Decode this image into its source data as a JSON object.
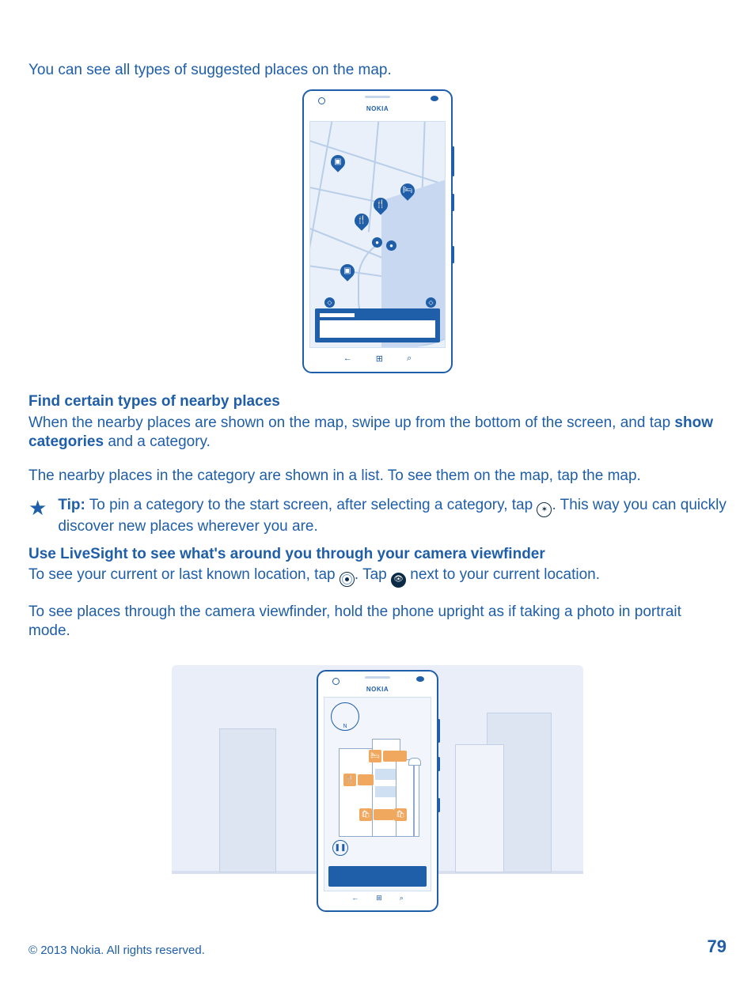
{
  "intro": "You can see all types of suggested places on the map.",
  "phone_brand": "NOKIA",
  "nav_btn_back": "←",
  "nav_btn_home": "⊞",
  "nav_btn_search": "⌕",
  "section1_heading": "Find certain types of nearby places",
  "section1_line1_a": "When the nearby places are shown on the map, swipe up from the bottom of the screen, and tap ",
  "section1_bold1": "show categories",
  "section1_line1_b": " and a category.",
  "section1_line2": "The nearby places in the category are shown in a list. To see them on the map, tap the map.",
  "tip_label": "Tip:",
  "tip_text_a": " To pin a category to the start screen, after selecting a category, tap ",
  "tip_text_b": ". This way you can quickly discover new places wherever you are.",
  "pin_icon_glyph": "✶",
  "section2_heading": "Use LiveSight to see what's around you through your camera viewfinder",
  "section2_line1_a": "To see your current or last known location, tap ",
  "section2_line1_b": ". Tap ",
  "section2_line1_c": " next to your current location.",
  "eye_icon_glyph": "👁",
  "section2_line2": "To see places through the camera viewfinder, hold the phone upright as if taking a photo in portrait mode.",
  "pause_glyph": "❚❚",
  "footer_copyright": "© 2013 Nokia. All rights reserved.",
  "page_number": "79"
}
